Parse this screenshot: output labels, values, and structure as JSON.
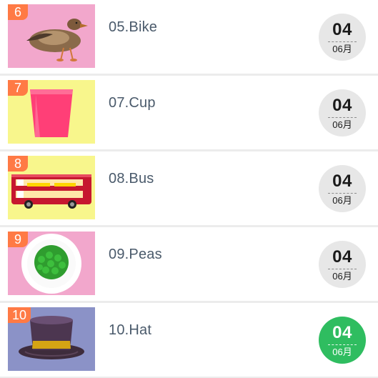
{
  "list": {
    "items": [
      {
        "rank": "6",
        "title": "05.Bike",
        "day": "04",
        "month": "06月",
        "thumb_icon": "duck-image",
        "thumb_bg": "#f2a7cc",
        "active": false
      },
      {
        "rank": "7",
        "title": "07.Cup",
        "day": "04",
        "month": "06月",
        "thumb_icon": "cup-image",
        "thumb_bg": "#f8f68c",
        "active": false
      },
      {
        "rank": "8",
        "title": "08.Bus",
        "day": "04",
        "month": "06月",
        "thumb_icon": "bus-image",
        "thumb_bg": "#f8f68c",
        "active": false
      },
      {
        "rank": "9",
        "title": "09.Peas",
        "day": "04",
        "month": "06月",
        "thumb_icon": "peas-image",
        "thumb_bg": "#f2a7cc",
        "active": false
      },
      {
        "rank": "10",
        "title": "10.Hat",
        "day": "04",
        "month": "06月",
        "thumb_icon": "hat-image",
        "thumb_bg": "#8b92c7",
        "active": true
      }
    ]
  },
  "colors": {
    "badge": "#ff7a45",
    "title_text": "#4a5a6b",
    "date_inactive": "#e7e7e7",
    "date_active": "#2fbd60",
    "top_indicator": "#36b7b8"
  }
}
